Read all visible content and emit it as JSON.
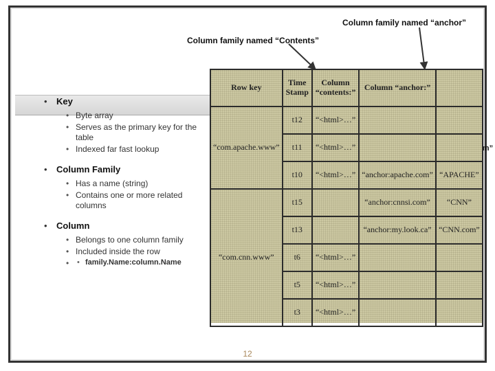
{
  "labels": {
    "anchor": "Column family named “anchor”",
    "contents": "Column family named “Contents”",
    "apache": "Column named “apache.com”"
  },
  "bullets": {
    "key": {
      "title": "Key",
      "items": [
        "Byte array",
        "Serves as the primary key for the table",
        "Indexed far fast lookup"
      ]
    },
    "cf": {
      "title": "Column Family",
      "items": [
        "Has a name (string)",
        "Contains one or more related columns"
      ]
    },
    "col": {
      "title": "Column",
      "items": [
        "Belongs to one column family",
        "Included inside the row"
      ],
      "subitems": [
        "family.Name:column.Name"
      ]
    }
  },
  "table": {
    "headers": [
      "Row key",
      "Time Stamp",
      "Column “contents:”",
      "Column “anchor:”",
      ""
    ],
    "rows": [
      {
        "rk": "",
        "ts": "t12",
        "c": "“<html>…”",
        "a1": "",
        "a2": ""
      },
      {
        "rk": "“com.apache.www”",
        "ts": "t11",
        "c": "“<html>…”",
        "a1": "",
        "a2": ""
      },
      {
        "rk": "",
        "ts": "t10",
        "c": "“<html>…”",
        "a1": "“anchor:apache.com”",
        "a2": "“APACHE”"
      },
      {
        "rk": "",
        "ts": "t15",
        "c": "",
        "a1": "“anchor:cnnsi.com”",
        "a2": "“CNN”"
      },
      {
        "rk": "",
        "ts": "t13",
        "c": "",
        "a1": "“anchor:my.look.ca”",
        "a2": "“CNN.com”"
      },
      {
        "rk": "“com.cnn.www”",
        "ts": "t6",
        "c": "“<html>…”",
        "a1": "",
        "a2": ""
      },
      {
        "rk": "",
        "ts": "t5",
        "c": "“<html>…”",
        "a1": "",
        "a2": ""
      },
      {
        "rk": "",
        "ts": "t3",
        "c": "“<html>…”",
        "a1": "",
        "a2": ""
      }
    ]
  },
  "pagenum": "12"
}
